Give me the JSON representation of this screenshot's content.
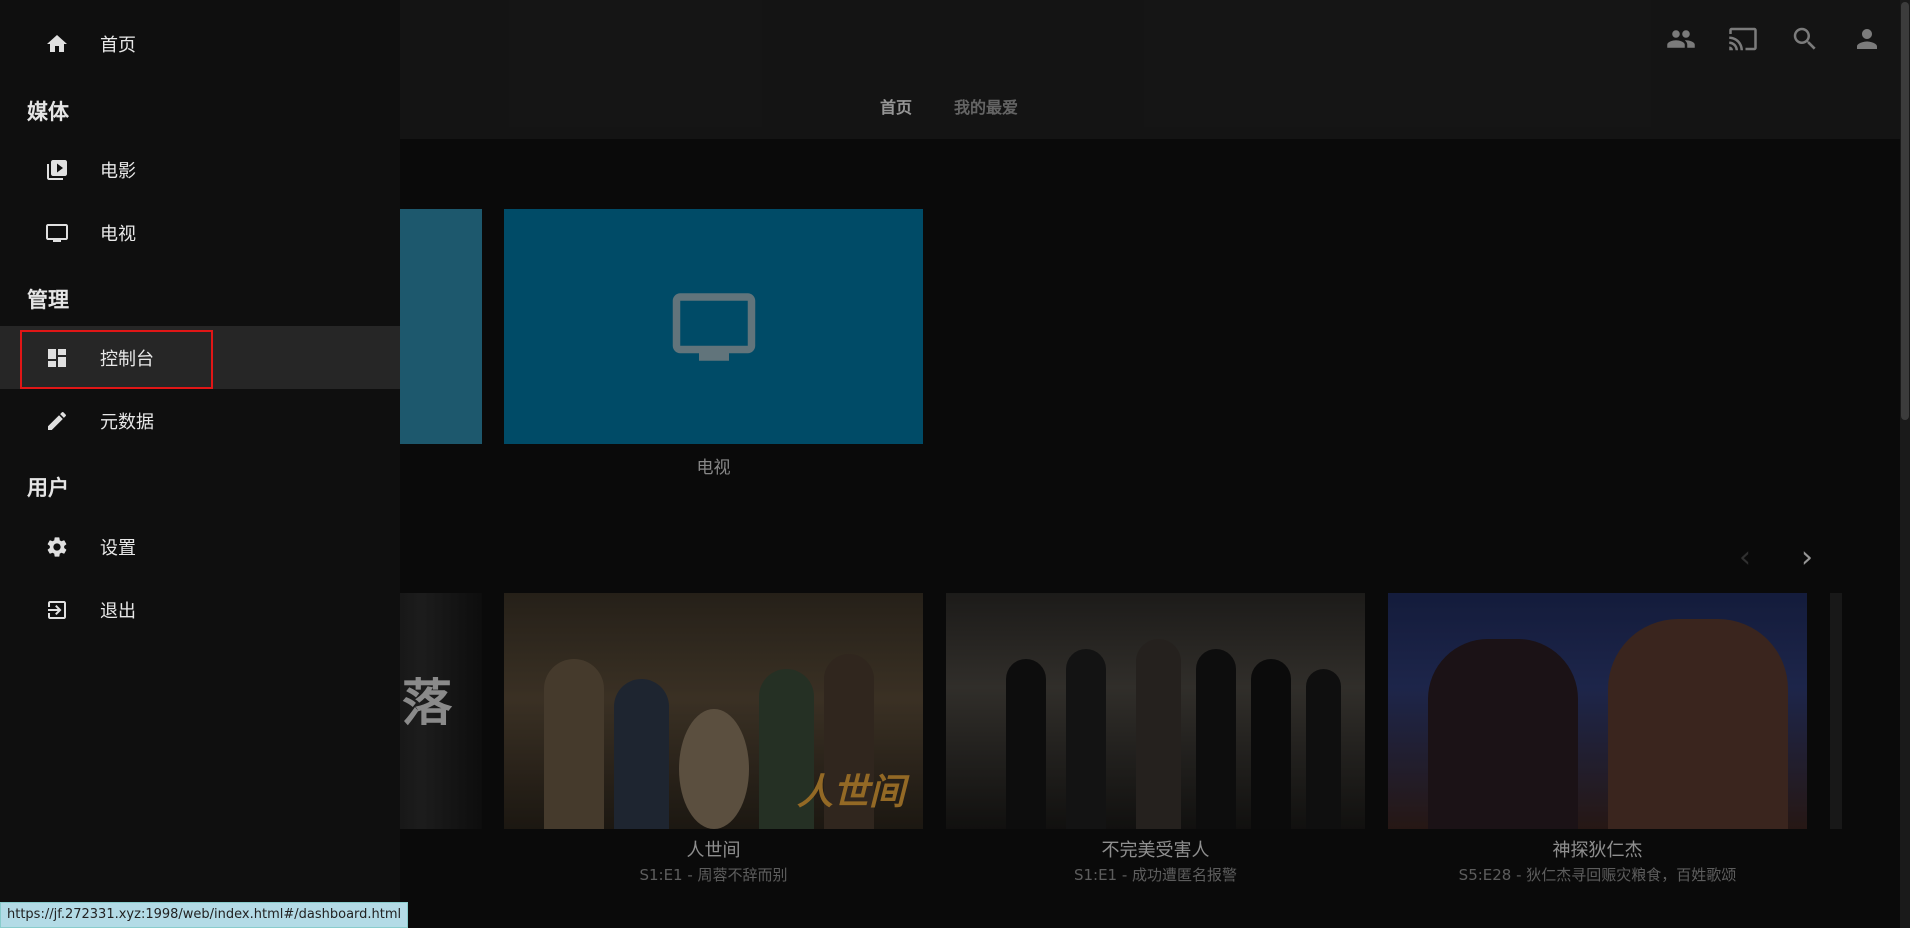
{
  "header": {
    "tabs": [
      {
        "label": "首页",
        "active": true
      },
      {
        "label": "我的最爱",
        "active": false
      }
    ],
    "icons": [
      "users-icon",
      "cast-icon",
      "search-icon",
      "account-icon"
    ]
  },
  "libraries": {
    "tv_label": "电视"
  },
  "continue_watching": {
    "partial_text": "落",
    "items": [
      {
        "title": "人世间",
        "subtitle": "S1:E1 - 周蓉不辞而别",
        "logo": "人世间"
      },
      {
        "title": "不完美受害人",
        "subtitle": "S1:E1 - 成功遭匿名报警"
      },
      {
        "title": "神探狄仁杰",
        "subtitle": "S5:E28 - 狄仁杰寻回赈灾粮食，百姓歌颂"
      }
    ]
  },
  "drawer": {
    "home": "首页",
    "section_media": "媒体",
    "movies": "电影",
    "tv": "电视",
    "section_admin": "管理",
    "dashboard": "控制台",
    "metadata": "元数据",
    "section_user": "用户",
    "settings": "设置",
    "signout": "退出"
  },
  "status_url": "https://jf.272331.xyz:1998/web/index.html#/dashboard.html",
  "colors": {
    "tv_tile": "#00739e",
    "movie_tile": "#2d87a8",
    "highlight_border": "#e01616"
  }
}
